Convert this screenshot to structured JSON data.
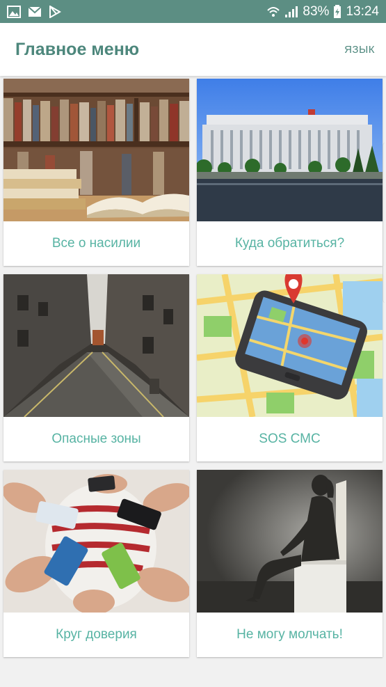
{
  "status_bar": {
    "battery": "83%",
    "time": "13:24",
    "icons": [
      "gallery-icon",
      "gmail-icon",
      "play-store-icon",
      "wifi-icon",
      "signal-icon",
      "battery-icon"
    ]
  },
  "header": {
    "title": "Главное меню",
    "lang_label": "ЯЗЫК"
  },
  "menu": {
    "items": [
      {
        "label": "Все о насилии",
        "image": "bookshelf-photo"
      },
      {
        "label": "Куда обратиться?",
        "image": "government-building-photo"
      },
      {
        "label": "Опасные зоны",
        "image": "dark-alley-photo"
      },
      {
        "label": "SOS СМС",
        "image": "phone-map-photo"
      },
      {
        "label": "Круг доверия",
        "image": "hands-phones-photo"
      },
      {
        "label": "Не могу молчать!",
        "image": "sitting-woman-photo"
      }
    ]
  },
  "colors": {
    "status_bar": "#5c8e83",
    "title": "#4d877c",
    "card_label": "#57b3a3",
    "background": "#f1f1f1"
  }
}
